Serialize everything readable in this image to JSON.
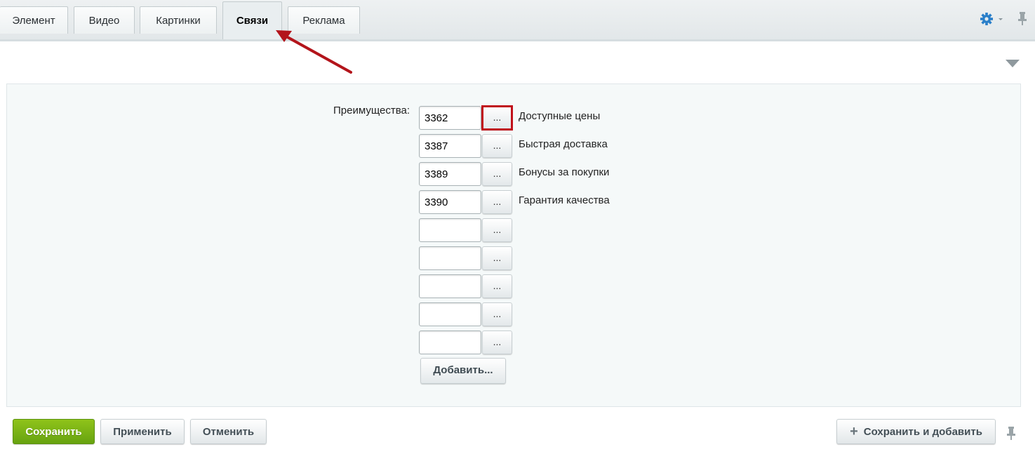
{
  "tabs": [
    {
      "label": "Элемент",
      "active": false
    },
    {
      "label": "Видео",
      "active": false
    },
    {
      "label": "Картинки",
      "active": false
    },
    {
      "label": "Связи",
      "active": true
    },
    {
      "label": "Реклама",
      "active": false
    }
  ],
  "icons": {
    "settings": "gear-icon",
    "pin": "pin-icon",
    "collapse": "triangle-down-icon",
    "add": "plus-icon"
  },
  "form": {
    "field_label": "Преимущества:",
    "rows": [
      {
        "value": "3362",
        "name": "Доступные цены",
        "button": "..."
      },
      {
        "value": "3387",
        "name": "Быстрая доставка",
        "button": "..."
      },
      {
        "value": "3389",
        "name": "Бонусы за покупки",
        "button": "..."
      },
      {
        "value": "3390",
        "name": "Гарантия качества",
        "button": "..."
      },
      {
        "value": "",
        "name": "",
        "button": "..."
      },
      {
        "value": "",
        "name": "",
        "button": "..."
      },
      {
        "value": "",
        "name": "",
        "button": "..."
      },
      {
        "value": "",
        "name": "",
        "button": "..."
      },
      {
        "value": "",
        "name": "",
        "button": "..."
      }
    ],
    "add_button": "Добавить..."
  },
  "footer": {
    "save": "Сохранить",
    "apply": "Применить",
    "cancel": "Отменить",
    "save_and_add": "Сохранить и добавить"
  },
  "colors": {
    "accent_green": "#7ab317",
    "highlight_red": "#c0111a",
    "gear_blue": "#2a7fc9"
  }
}
